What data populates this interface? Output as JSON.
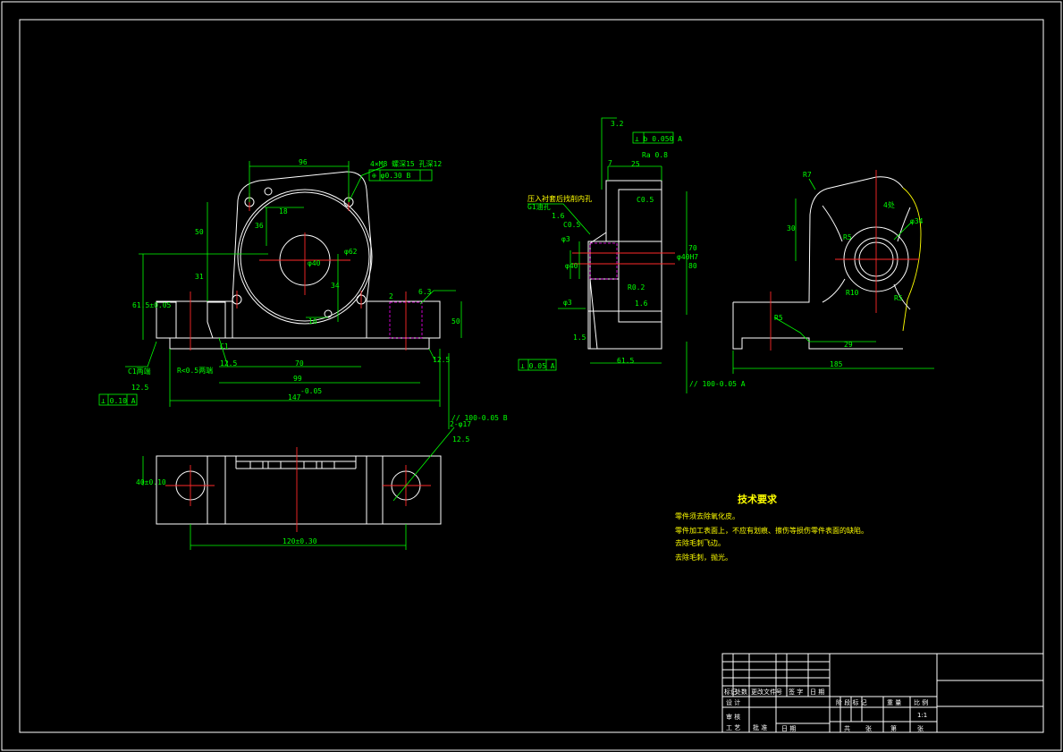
{
  "front_view": {
    "dims": {
      "top_width": "96",
      "hole_spec": "4×M8 螺深15 孔深12",
      "position_tol": "⊕ φ0.30 B",
      "d18": "18",
      "d36": "36",
      "d50": "50",
      "d31": "31",
      "phi62": "φ62",
      "phi40": "φ40",
      "d34": "34",
      "d16": "16",
      "center_height": "61.5±0.05",
      "d70": "70",
      "d99": "99",
      "overall_length": "147",
      "overall_length_tol": "-0.05",
      "d50r": "50",
      "right_tol": "// 100-0.05 B",
      "d2": "2",
      "rough_63": "6.3",
      "c1_both": "C1两端",
      "c1_both_ra": "12.5",
      "r05_both": "R<0.5两端",
      "c1": "C1",
      "c1_ra": "12.5",
      "ra_right": "12.5",
      "flat_tol": "⊥ 0.10 A"
    }
  },
  "side_view": {
    "dims": {
      "ra32": "3.2",
      "perp_tol": "⊥ b 0.050 A",
      "d7": "7",
      "d25": "25",
      "ra": "Ra 0.8",
      "press_note": "压入衬套后找削内孔",
      "oil_hole": "G1油孔",
      "ra16": "1.6",
      "c05a": "C0.5",
      "c05b": "C0.5",
      "phi3": "φ3",
      "phi40h7": "φ40H7",
      "phi40": "φ40",
      "r02": "R0.2",
      "ra16b": "1.6",
      "phi_hole": "φ3",
      "ra15": "1.5",
      "d61": "61.5",
      "bottom_tol": "⊥ 0.05 A",
      "right_tol": "// 100-0.05 A",
      "d70": "70",
      "d80": "80"
    }
  },
  "right_view": {
    "dims": {
      "r7": "R7",
      "d30": "30",
      "r5a": "R5",
      "r10": "R10",
      "r5b": "R5",
      "r5c": "R5",
      "phi34": "φ34",
      "four_places": "4处",
      "d29": "29",
      "d185": "185"
    }
  },
  "bottom_view": {
    "dims": {
      "left": "40±0.10",
      "holes": "2-φ17",
      "holes_ra": "12.5",
      "spacing": "120±0.30"
    }
  },
  "tech_requirements": {
    "title": "技术要求",
    "items": [
      "零件须去除氧化皮。",
      "零件加工表面上，不应有划痕、擦伤等损伤零件表面的缺陷。",
      "去除毛刺飞边。",
      "去除毛刺，抛光。"
    ]
  },
  "title_block": {
    "row_labels": [
      "标记",
      "处数",
      "更改文件号",
      "签 字",
      "日 期"
    ],
    "design": "设 计",
    "stage": "阶 段 标 记",
    "weight": "重 量",
    "scale": "比 例",
    "scale_value": "1:1",
    "review": "审 核",
    "craft": "工 艺",
    "approve": "批 准",
    "date": "日 期",
    "sheet_a": "共",
    "sheet_b": "张",
    "sheet_c": "第",
    "sheet_d": "张"
  }
}
